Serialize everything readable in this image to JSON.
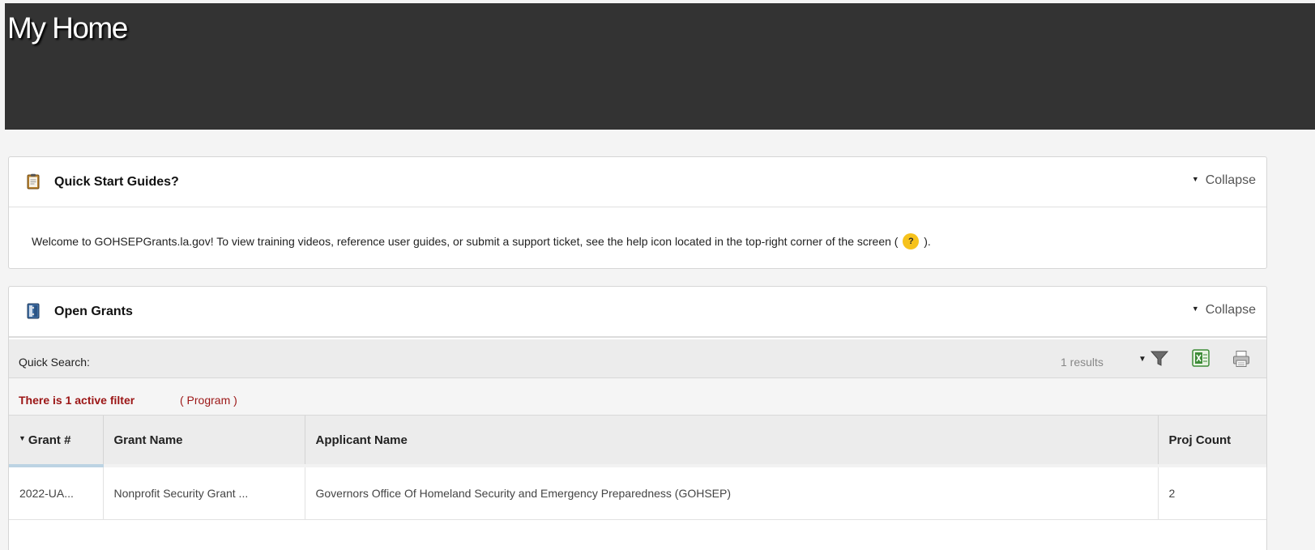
{
  "page": {
    "title": "My Home"
  },
  "quick_start": {
    "title": "Quick Start Guides?",
    "collapse_label": "Collapse",
    "welcome_before": "Welcome to GOHSEPGrants.la.gov! To view training videos, reference user guides, or submit a support ticket, see the help icon located in the top-right corner of the screen (",
    "help_icon_glyph": "?",
    "welcome_after": ").",
    "icon": "clipboard-icon"
  },
  "open_grants": {
    "title": "Open Grants",
    "collapse_label": "Collapse",
    "icon": "binder-icon",
    "toolbar": {
      "quick_search_label": "Quick Search:",
      "results_text": "1 results",
      "icons": [
        "filter-icon",
        "excel-export-icon",
        "print-icon"
      ]
    },
    "filter_notice": {
      "text": "There is 1 active filter",
      "link": "( Program )"
    },
    "columns": [
      "Grant #",
      "Grant Name",
      "Applicant Name",
      "Proj Count"
    ],
    "rows": [
      {
        "grant_number": "2022-UA...",
        "grant_name": "Nonprofit Security Grant ...",
        "applicant_name": "Governors Office Of Homeland Security and Emergency Preparedness (GOHSEP)",
        "proj_count": "2"
      }
    ]
  },
  "colors": {
    "header_bg": "#333333",
    "page_bg": "#f4f4f4",
    "filter_text": "#9b1515",
    "help_badge": "#f6c21c",
    "sorted_col_accent": "#bcd3e3"
  }
}
